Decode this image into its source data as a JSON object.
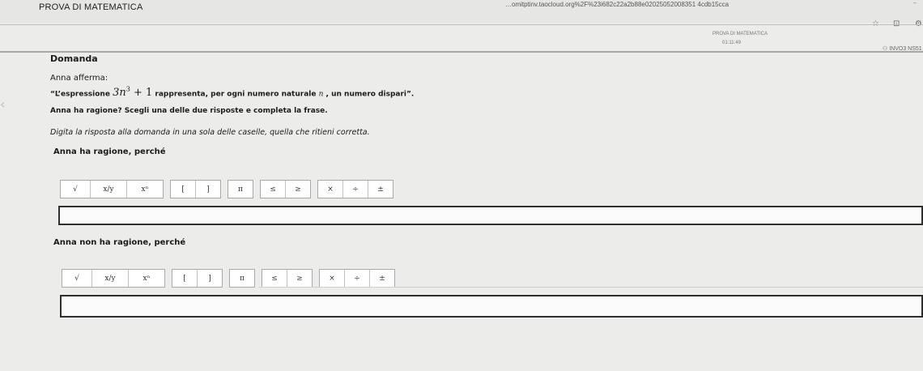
{
  "app": {
    "title": "PROVA DI MATEMATICA",
    "url": "…omitptinv.taocloud.org%2F%23i682c22a2b88e02025052008351 4cdb15cca"
  },
  "exam": {
    "title": "PROVA DI MATEMATICA",
    "timer": "01:11:49",
    "user": "INVO3 NS51"
  },
  "question": {
    "label": "Domanda",
    "stem_line1": "Anna afferma:",
    "stem_line2_prefix": "“L’espressione",
    "stem_expr_base": "3n",
    "stem_expr_exp": "3",
    "stem_expr_rest": "+ 1",
    "stem_line2_mid": "rappresenta, per ogni numero naturale",
    "stem_var": "n",
    "stem_line2_suffix": ", un numero dispari”.",
    "stem_line3": "Anna ha ragione? Scegli una delle due risposte e completa la frase.",
    "stem_line4": "Digita la risposta alla domanda in una sola delle caselle, quella che ritieni corretta."
  },
  "options": [
    {
      "label": "Anna ha ragione, perché",
      "answer": ""
    },
    {
      "label": "Anna non ha ragione, perché",
      "answer": ""
    }
  ],
  "toolbar": {
    "sqrt": "√",
    "fraction": "x/y",
    "power": "xⁿ",
    "bracket_open": "[",
    "bracket_close": "]",
    "pi": "π",
    "leq": "≤",
    "geq": "≥",
    "times": "×",
    "divide": "÷",
    "plusminus": "±"
  },
  "icons": {
    "star": "star-icon",
    "collapse": "window-collapse-icon",
    "settings": "gear-icon",
    "prev": "chevron-left-icon"
  }
}
